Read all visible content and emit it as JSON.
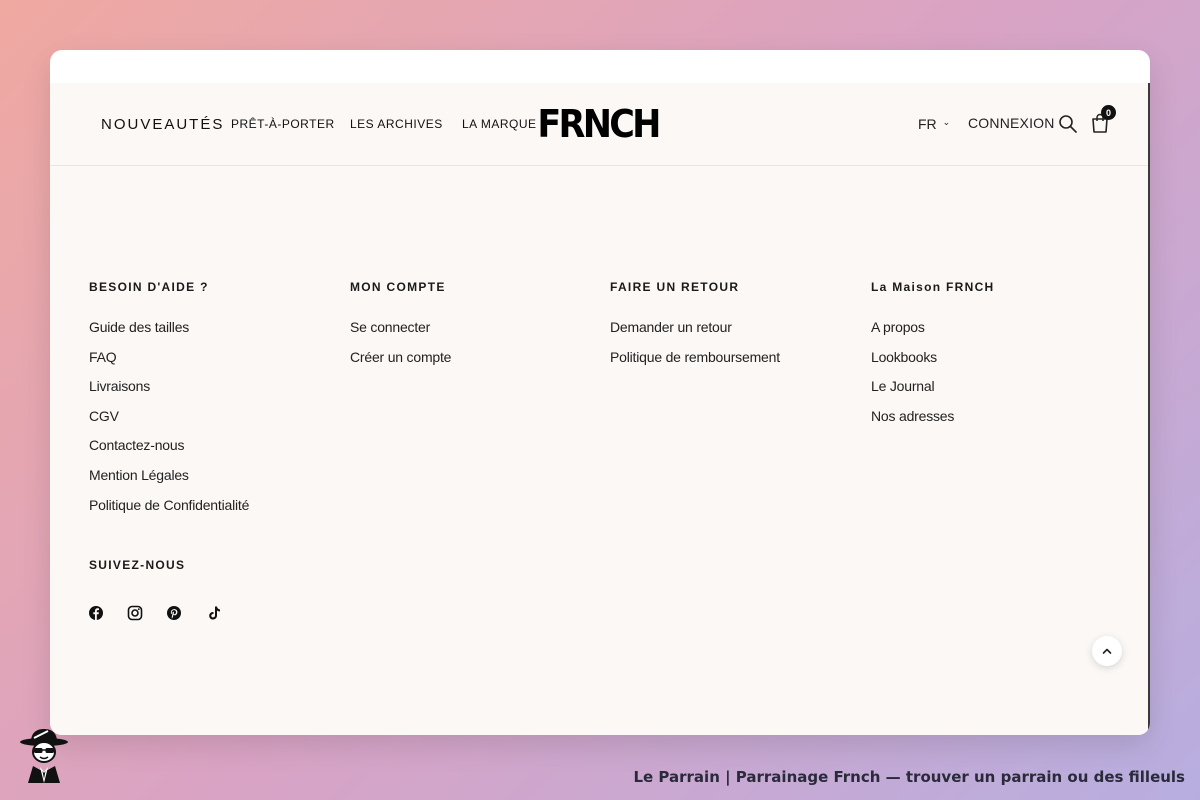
{
  "header": {
    "nav": [
      "NOUVEAUTÉS",
      "PRÊT-À-PORTER",
      "LES ARCHIVES",
      "LA MARQUE"
    ],
    "logo_text": "FRNCH",
    "language": "FR",
    "login_label": "CONNEXION",
    "cart_count": "0"
  },
  "footer": {
    "columns": [
      {
        "title": "BESOIN D'AIDE ?",
        "links": [
          "Guide des tailles",
          "FAQ",
          "Livraisons",
          "CGV",
          "Contactez-nous",
          "Mention Légales",
          "Politique de Confidentialité"
        ]
      },
      {
        "title": "MON COMPTE",
        "links": [
          "Se connecter",
          "Créer un compte"
        ]
      },
      {
        "title": "FAIRE UN RETOUR",
        "links": [
          "Demander un retour",
          "Politique de remboursement"
        ]
      },
      {
        "title": "La Maison FRNCH",
        "links": [
          "A propos",
          "Lookbooks",
          "Le Journal",
          "Nos adresses"
        ]
      }
    ],
    "follow_title": "SUIVEZ-NOUS",
    "social_icons": [
      "facebook-icon",
      "instagram-icon",
      "pinterest-icon",
      "tiktok-icon"
    ]
  },
  "caption": "Le Parrain | Parrainage Frnch — trouver un parrain ou des filleuls",
  "colors": {
    "page_background": "#fcf8f5",
    "text": "#1a1a1a",
    "cart_badge": "#111111"
  }
}
